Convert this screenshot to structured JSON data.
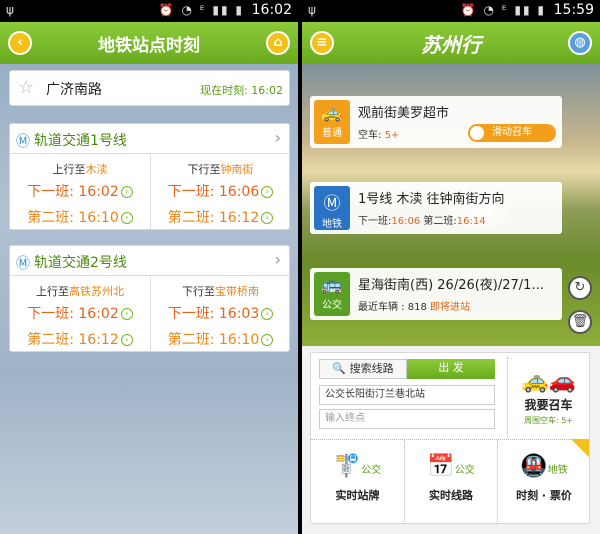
{
  "left": {
    "status": {
      "time": "16:02"
    },
    "title": "地铁站点时刻",
    "station": {
      "name": "广济南路",
      "now_label": "现在时刻: 16:02"
    },
    "lines": [
      {
        "name": "轨道交通1号线",
        "up": {
          "prefix": "上行至",
          "dest": "木渎",
          "next": "下一班: 16:02",
          "second": "第二班: 16:10"
        },
        "down": {
          "prefix": "下行至",
          "dest": "钟南街",
          "next": "下一班: 16:06",
          "second": "第二班: 16:12"
        }
      },
      {
        "name": "轨道交通2号线",
        "up": {
          "prefix": "上行至",
          "dest": "高铁苏州北",
          "next": "下一班: 16:02",
          "second": "第二班: 16:12"
        },
        "down": {
          "prefix": "下行至",
          "dest": "宝带桥南",
          "next": "下一班: 16:03",
          "second": "第二班: 16:10"
        }
      }
    ]
  },
  "right": {
    "status": {
      "time": "15:59"
    },
    "title": "苏州行",
    "cards": [
      {
        "badge": "普通",
        "icon": "taxi-icon",
        "main": "观前街美罗超市",
        "sub_label": "空车:",
        "sub_value": "5+",
        "toggle": "滑动召车"
      },
      {
        "badge": "地铁",
        "icon": "metro-icon",
        "main": "1号线 木渎 往钟南街方向",
        "sub_label": "下一班:",
        "sub_value": "16:06",
        "sub2_label": "第二班:",
        "sub2_value": "16:14"
      },
      {
        "badge": "公交",
        "icon": "bus-icon",
        "main": "星海街南(西) 26/26(夜)/27/1...",
        "sub_label": "最近车辆 : 818",
        "sub_value": "即将进站"
      }
    ],
    "panel": {
      "tab_search": "搜索线路",
      "tab_go": "出 发",
      "from_value": "公交长阳街汀兰巷北站",
      "to_placeholder": "输入终点",
      "callcar_label": "我要召车",
      "callcar_sub": "周围空车: 5+",
      "grid": [
        {
          "label": "实时站牌",
          "icon": "bus-stop-icon",
          "tag": "公交"
        },
        {
          "label": "实时线路",
          "icon": "calendar-15-icon",
          "tag": "公交"
        },
        {
          "label": "时刻 · 票价",
          "icon": "metro-train-icon",
          "tag": "地铁"
        }
      ]
    }
  }
}
